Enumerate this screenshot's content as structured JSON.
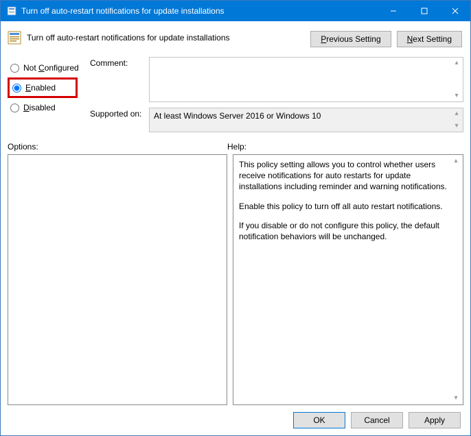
{
  "titlebar": {
    "title": "Turn off auto-restart notifications for update installations"
  },
  "header": {
    "title": "Turn off auto-restart notifications for update installations",
    "prev": "Previous Setting",
    "next": "Next Setting"
  },
  "radios": {
    "not_configured": "Not Configured",
    "enabled": "Enabled",
    "disabled": "Disabled",
    "selected": "enabled"
  },
  "fields": {
    "comment_label": "Comment:",
    "comment_value": "",
    "supported_label": "Supported on:",
    "supported_value": "At least Windows Server 2016 or Windows 10"
  },
  "labels": {
    "options": "Options:",
    "help": "Help:"
  },
  "help": {
    "p1": "This policy setting allows you to control whether users receive notifications for auto restarts for update installations including reminder and warning notifications.",
    "p2": "Enable this policy to turn off all auto restart notifications.",
    "p3": "If you disable or do not configure this policy, the default notification behaviors will be unchanged."
  },
  "footer": {
    "ok": "OK",
    "cancel": "Cancel",
    "apply": "Apply"
  }
}
